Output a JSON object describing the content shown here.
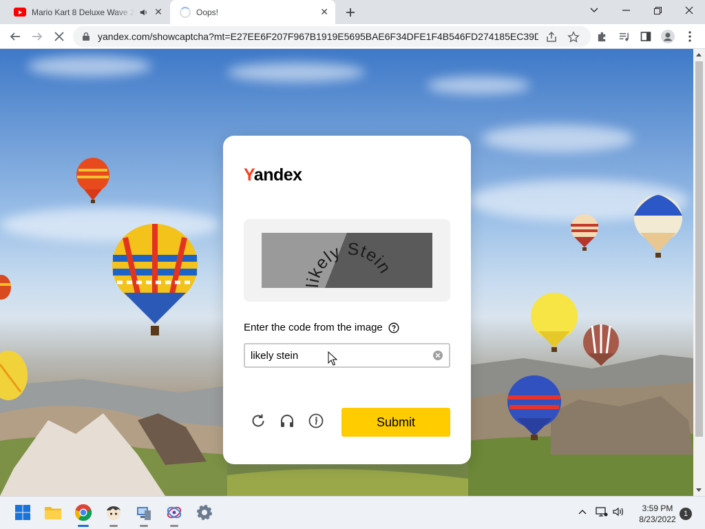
{
  "browser": {
    "tabs": [
      {
        "title": "Mario Kart 8 Deluxe Wave 2",
        "favicon": "youtube-icon",
        "audio": true,
        "active": false
      },
      {
        "title": "Oops!",
        "favicon": "loading-spinner-icon",
        "active": true
      }
    ],
    "url": "yandex.com/showcaptcha?mt=E27EE6F207F967B1919E5695BAE6F34DFE1F4B546FD274185EC39D334..."
  },
  "captcha": {
    "logo_y": "Y",
    "logo_rest": "andex",
    "image_text": "likely Stein",
    "prompt": "Enter the code from the image",
    "input_value": "likely stein",
    "submit_label": "Submit"
  },
  "taskbar": {
    "time": "3:59 PM",
    "date": "8/23/2022",
    "notification_count": "1"
  },
  "colors": {
    "brand_red": "#fc3f1d",
    "submit_yellow": "#ffcc00"
  }
}
